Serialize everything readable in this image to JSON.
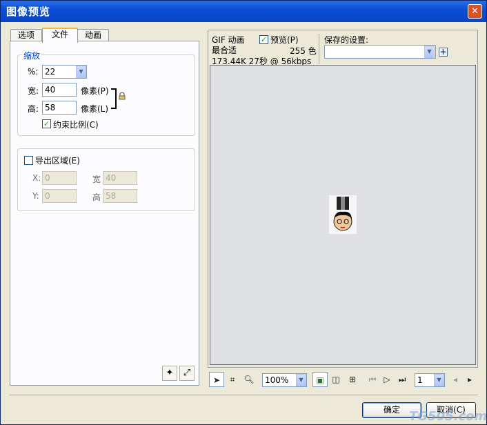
{
  "window": {
    "title": "图像预览",
    "close_glyph": "✕"
  },
  "tabs": [
    {
      "label": "选项"
    },
    {
      "label": "文件"
    },
    {
      "label": "动画"
    }
  ],
  "scale_group": {
    "title": "缩放",
    "percent_label": "%:",
    "percent_value": "22",
    "width_label": "宽:",
    "width_value": "40",
    "width_unit": "像素(P)",
    "height_label": "高:",
    "height_value": "58",
    "height_unit": "像素(L)",
    "constrain_label": "约束比例(C)",
    "constrain_checked": true
  },
  "export_group": {
    "checkbox_label": "导出区域(E)",
    "checked": false,
    "x_label": "X:",
    "x_value": "0",
    "y_label": "Y:",
    "y_value": "0",
    "w_label": "宽",
    "w_value": "40",
    "h_label": "高",
    "h_value": "58"
  },
  "preview_info": {
    "format": "GIF 动画",
    "quality": "最合适",
    "stats": "173.44K  27秒 @ 56kbps",
    "preview_label": "预览(P)",
    "preview_checked": true,
    "colors": "255 色",
    "saved_settings_label": "保存的设置:",
    "saved_settings_value": ""
  },
  "toolbar": {
    "zoom_value": "100%",
    "frame_value": "1"
  },
  "buttons": {
    "ok": "确定",
    "cancel": "取消(C)"
  },
  "watermark": "TG505.com"
}
